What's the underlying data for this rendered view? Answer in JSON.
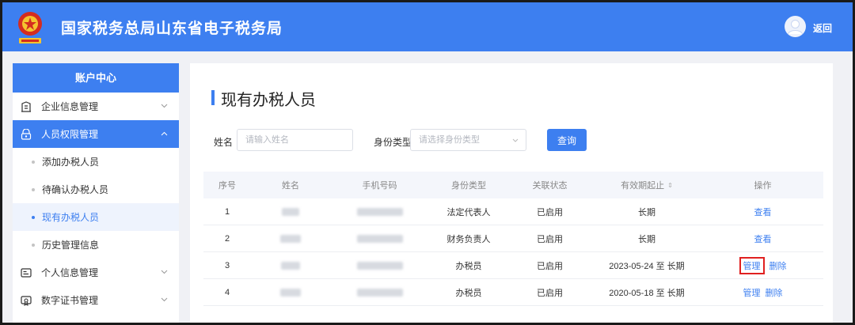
{
  "header": {
    "title": "国家税务总局山东省电子税务局",
    "back_label": "返回",
    "logo_icon": "tax-emblem-icon",
    "brand_color": "#3d7ff0"
  },
  "sidebar": {
    "title": "账户中心",
    "groups": [
      {
        "label": "企业信息管理",
        "icon": "building-icon",
        "expanded": false
      },
      {
        "label": "人员权限管理",
        "icon": "user-lock-icon",
        "expanded": true,
        "items": [
          "添加办税人员",
          "待确认办税人员",
          "现有办税人员",
          "历史管理信息"
        ]
      },
      {
        "label": "个人信息管理",
        "icon": "id-card-icon",
        "expanded": false
      },
      {
        "label": "数字证书管理",
        "icon": "certificate-icon",
        "expanded": false
      }
    ]
  },
  "main": {
    "title": "现有办税人员",
    "search": {
      "name_label": "姓名",
      "name_placeholder": "请输入姓名",
      "type_label": "身份类型",
      "type_placeholder": "请选择身份类型",
      "query_button": "查询"
    },
    "table": {
      "columns": [
        "序号",
        "姓名",
        "手机号码",
        "身份类型",
        "关联状态",
        "有效期起止",
        "操作"
      ],
      "rows": [
        {
          "no": "1",
          "type": "法定代表人",
          "status": "已启用",
          "validity": "长期",
          "actions": [
            "查看"
          ]
        },
        {
          "no": "2",
          "type": "财务负责人",
          "status": "已启用",
          "validity": "长期",
          "actions": [
            "查看"
          ]
        },
        {
          "no": "3",
          "type": "办税员",
          "status": "已启用",
          "validity": "2023-05-24 至 长期",
          "actions": [
            "管理",
            "删除"
          ]
        },
        {
          "no": "4",
          "type": "办税员",
          "status": "已启用",
          "validity": "2020-05-18 至 长期",
          "actions": [
            "管理",
            "删除"
          ]
        }
      ]
    }
  }
}
